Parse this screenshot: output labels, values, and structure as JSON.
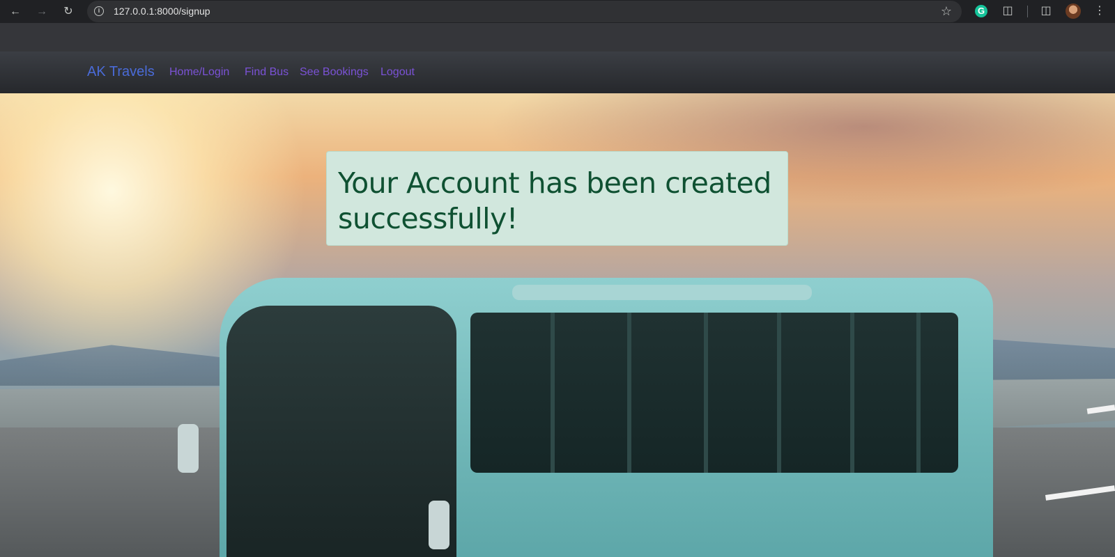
{
  "browser": {
    "url": "127.0.0.1:8000/signup",
    "icons": [
      "back-icon",
      "forward-icon",
      "reload-icon",
      "info-icon",
      "star-icon",
      "grammarly-icon",
      "extensions-icon",
      "side-panel-icon",
      "profile-avatar",
      "menu-icon"
    ],
    "grammarly_glyph": "G"
  },
  "navbar": {
    "brand": "AK Travels",
    "links": [
      "Home/Login",
      "Find Bus",
      "See Bookings",
      "Logout"
    ]
  },
  "alert": {
    "message": "Your Account has been created successfully!"
  },
  "colors": {
    "brand": "#4a6bd8",
    "nav_link": "#7b52d6",
    "alert_bg": "#d1e7dd",
    "alert_text": "#0f5132"
  }
}
